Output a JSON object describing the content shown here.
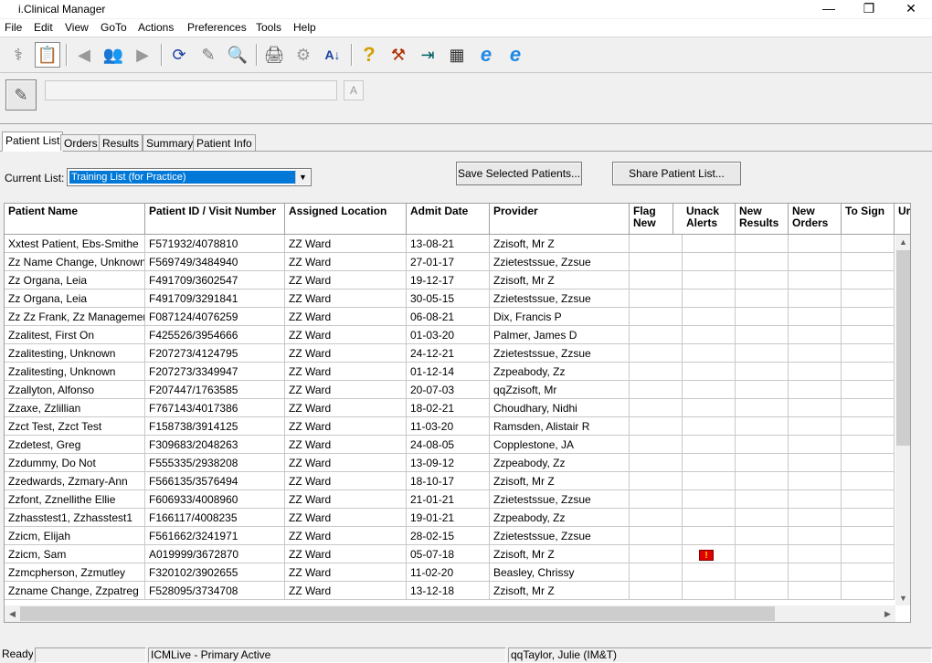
{
  "window": {
    "title": "i.Clinical Manager",
    "minimize": "—",
    "maximize": "❐",
    "close": "✕"
  },
  "menu": [
    "File",
    "Edit",
    "View",
    "GoTo",
    "Actions",
    "Preferences",
    "Tools",
    "Help"
  ],
  "toolbar": {
    "icons": [
      "patient-tools-icon",
      "clipboard-icon",
      "back-arrow-icon",
      "people-icon",
      "forward-arrow-icon",
      "refresh-icon",
      "notes-icon",
      "search-icon",
      "printer-icon",
      "tools-icon",
      "sort-az-icon",
      "help-icon",
      "settings-icon",
      "exit-icon",
      "calculator-icon",
      "internet-explorer-icon",
      "internet-explorer-icon-2"
    ],
    "glyphs": [
      "⚕",
      "📋",
      "◀",
      "👥",
      "▶",
      "⟳",
      "✎",
      "🔍",
      "🖨",
      "⚙",
      "A↓",
      "?",
      "⚒",
      "⇥",
      "▦",
      "e",
      "e"
    ]
  },
  "subtoolbar": {
    "search_value": "",
    "a_label": "A"
  },
  "tabs": [
    "Patient List",
    "Orders",
    "Results",
    "Summary",
    "Patient Info"
  ],
  "list": {
    "label": "Current List:",
    "selected": "Training List (for Practice)",
    "save_button": "Save Selected Patients...",
    "share_button": "Share Patient List..."
  },
  "table": {
    "columns": [
      "Patient Name",
      "Patient ID / Visit Number",
      "Assigned Location",
      "Admit Date",
      "Provider",
      "Flag New",
      "Unack Alerts",
      "New Results",
      "New Orders",
      "To Sign",
      "Ur"
    ],
    "rows": [
      [
        "Xxtest Patient, Ebs-Smithe",
        "F571932/4078810",
        "ZZ Ward",
        "13-08-21",
        "Zzisoft, Mr Z",
        "",
        ""
      ],
      [
        "Zz Name Change, Unknown",
        "F569749/3484940",
        "ZZ Ward",
        "27-01-17",
        "Zzietestssue, Zzsue",
        "",
        ""
      ],
      [
        "Zz Organa, Leia",
        "F491709/3602547",
        "ZZ Ward",
        "19-12-17",
        "Zzisoft, Mr Z",
        "",
        ""
      ],
      [
        "Zz Organa, Leia",
        "F491709/3291841",
        "ZZ Ward",
        "30-05-15",
        "Zzietestssue, Zzsue",
        "",
        ""
      ],
      [
        "Zz Zz Frank, Zz Management",
        "F087124/4076259",
        "ZZ Ward",
        "06-08-21",
        "Dix, Francis P",
        "",
        ""
      ],
      [
        "Zzalitest, First On",
        "F425526/3954666",
        "ZZ Ward",
        "01-03-20",
        "Palmer, James D",
        "",
        ""
      ],
      [
        "Zzalitesting, Unknown",
        "F207273/4124795",
        "ZZ Ward",
        "24-12-21",
        "Zzietestssue, Zzsue",
        "",
        ""
      ],
      [
        "Zzalitesting, Unknown",
        "F207273/3349947",
        "ZZ Ward",
        "01-12-14",
        "Zzpeabody, Zz",
        "",
        ""
      ],
      [
        "Zzallyton, Alfonso",
        "F207447/1763585",
        "ZZ Ward",
        "20-07-03",
        "qqZzisoft, Mr",
        "",
        ""
      ],
      [
        "Zzaxe, Zzlillian",
        "F767143/4017386",
        "ZZ Ward",
        "18-02-21",
        "Choudhary, Nidhi",
        "",
        ""
      ],
      [
        "Zzct Test, Zzct Test",
        "F158738/3914125",
        "ZZ Ward",
        "11-03-20",
        "Ramsden, Alistair R",
        "",
        ""
      ],
      [
        "Zzdetest, Greg",
        "F309683/2048263",
        "ZZ Ward",
        "24-08-05",
        "Copplestone, JA",
        "",
        ""
      ],
      [
        "Zzdummy, Do Not",
        "F555335/2938208",
        "ZZ Ward",
        "13-09-12",
        "Zzpeabody, Zz",
        "",
        ""
      ],
      [
        "Zzedwards, Zzmary-Ann",
        "F566135/3576494",
        "ZZ Ward",
        "18-10-17",
        "Zzisoft, Mr Z",
        "",
        ""
      ],
      [
        "Zzfont, Zznellithe Ellie",
        "F606933/4008960",
        "ZZ Ward",
        "21-01-21",
        "Zzietestssue, Zzsue",
        "",
        ""
      ],
      [
        "Zzhasstest1, Zzhasstest1",
        "F166117/4008235",
        "ZZ Ward",
        "19-01-21",
        "Zzpeabody, Zz",
        "",
        ""
      ],
      [
        "Zzicm, Elijah",
        "F561662/3241971",
        "ZZ Ward",
        "28-02-15",
        "Zzietestssue, Zzsue",
        "",
        ""
      ],
      [
        "Zzicm, Sam",
        "A019999/3672870",
        "ZZ Ward",
        "05-07-18",
        "Zzisoft, Mr Z",
        "",
        "!"
      ],
      [
        "Zzmcpherson, Zzmutley",
        "F320102/3902655",
        "ZZ Ward",
        "11-02-20",
        "Beasley, Chrissy",
        "",
        ""
      ],
      [
        "Zzname Change, Zzpatreg",
        "F528095/3734708",
        "ZZ Ward",
        "13-12-18",
        "Zzisoft, Mr Z",
        "",
        ""
      ]
    ]
  },
  "statusbar": [
    "Ready",
    "",
    "ICMLive - Primary Active",
    "qqTaylor, Julie (IM&T)"
  ]
}
